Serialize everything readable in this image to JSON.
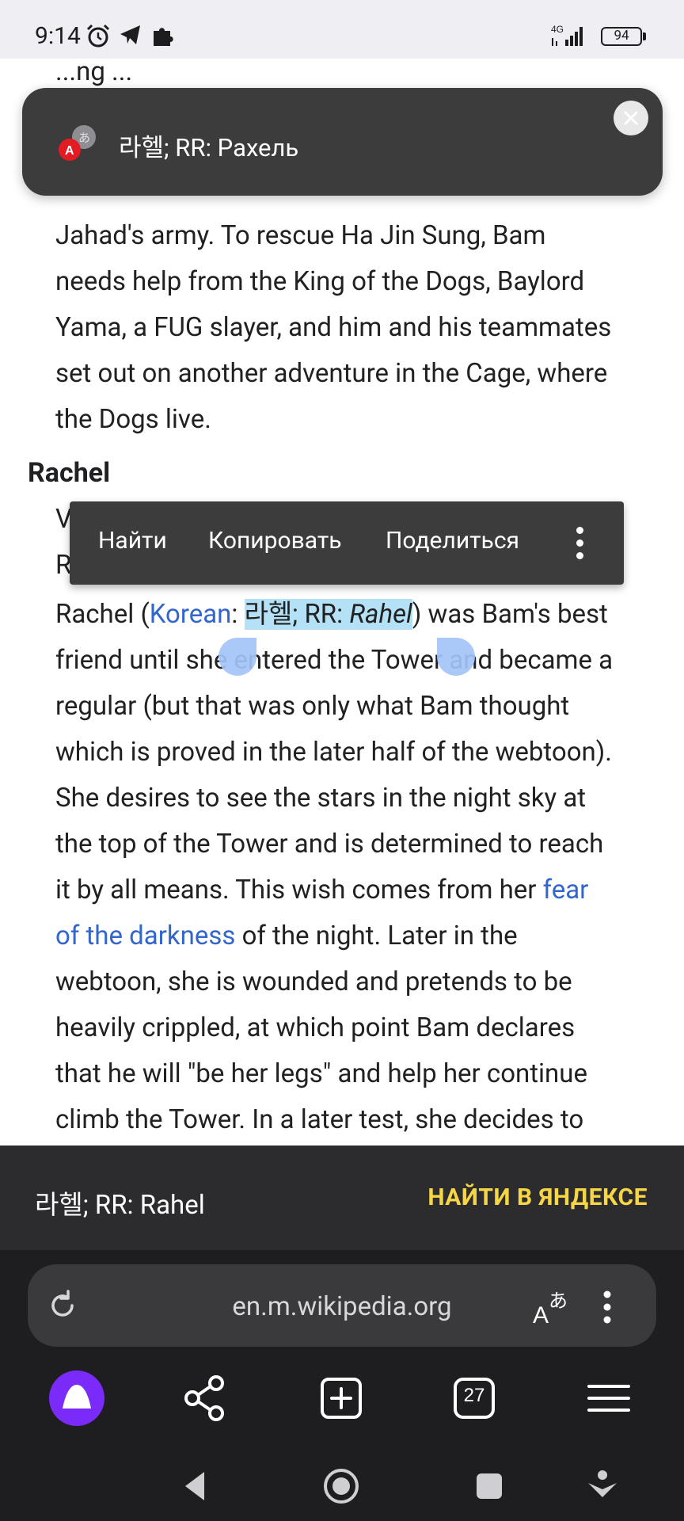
{
  "status_bar": {
    "time": "9:14",
    "network": "4G",
    "battery": "94"
  },
  "toast": {
    "text": "라헬; RR: Рахель"
  },
  "article": {
    "ghost_line_1": "Jahad's army. To rescue Ha Jin Sung, Bam",
    "ghost_top_fragment_1": "...ng ...",
    "para1": {
      "line1": "Jahad's army. To rescue Ha Jin Sung, Bam",
      "line2": "needs help from the King of the Dogs, Baylord",
      "line3": "Yama, a FUG slayer, and him and his teammates",
      "line4": "set out on another adventure in the Cage, where",
      "line5": "the Dogs live."
    },
    "heading": "Rachel",
    "hidden_line_a": "V",
    "hidden_line_b": "R",
    "para2": {
      "l1_pre": "Rachel (",
      "l1_link": "Korean",
      "l1_colon": ": ",
      "l1_selected_a": "라헬; RR: ",
      "l1_selected_b": "Rahel",
      "l1_post": ") was Bam's best",
      "l2": "friend until she entered the Tower and became a",
      "l3": "regular (but that was only what Bam thought",
      "l4": "which is proved in the later half of the webtoon).",
      "l5": "She desires to see the stars in the night sky at",
      "l6": "the top of the Tower and is determined to reach",
      "l7_pre": "it by all means. This wish comes from her ",
      "l7_link": "fear",
      "l8_link": "of the darkness",
      "l8_post": " of the night. Later in the",
      "l9": "webtoon, she is wounded and pretends to be",
      "l10": "heavily crippled, at which point Bam declares",
      "l11": "that he will \"be her legs\" and help her continue",
      "l12": "climb the Tower. In a later test, she decides to"
    }
  },
  "context_menu": {
    "find": "Найти",
    "copy": "Копировать",
    "share": "Поделиться"
  },
  "search_bar": {
    "query": "라헬; RR: Rahel",
    "action": "НАЙТИ В ЯНДЕКСЕ"
  },
  "browser": {
    "url": "en.m.wikipedia.org",
    "tabs_count": "27"
  },
  "colors": {
    "link": "#3366cc",
    "selection": "#b4e1f6",
    "yandex_action": "#f6d645",
    "alice_button": "#7b2bf9"
  }
}
